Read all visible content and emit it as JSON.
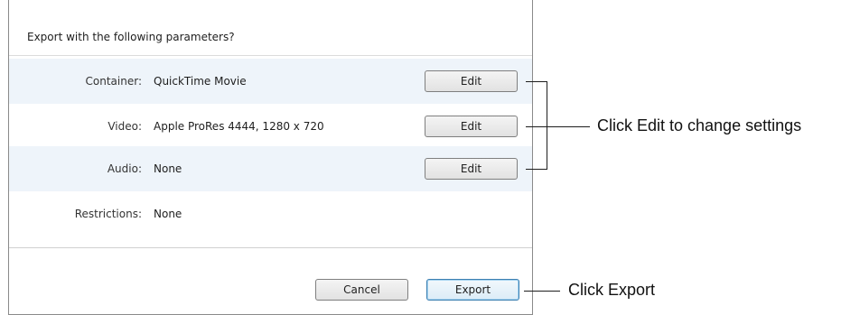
{
  "dialog": {
    "prompt": "Export with the following parameters?",
    "rows": [
      {
        "label": "Container:",
        "value": "QuickTime Movie",
        "edit_label": "Edit"
      },
      {
        "label": "Video:",
        "value": "Apple ProRes 4444, 1280 x 720",
        "edit_label": "Edit"
      },
      {
        "label": "Audio:",
        "value": "None",
        "edit_label": "Edit"
      },
      {
        "label": "Restrictions:",
        "value": "None"
      }
    ],
    "cancel_label": "Cancel",
    "export_label": "Export"
  },
  "callouts": {
    "edit": "Click Edit to change settings",
    "export": "Click Export"
  },
  "colors": {
    "row_shade": "#eef4fa",
    "default_button_border": "#3c7fb1"
  }
}
